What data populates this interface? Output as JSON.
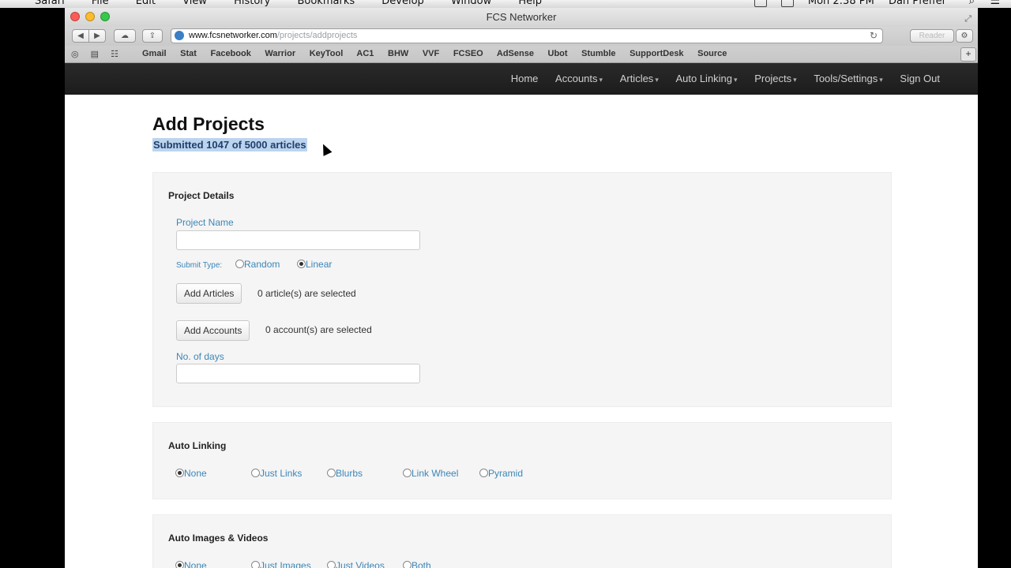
{
  "os_menubar": {
    "app": "Safari",
    "menus": [
      "Safari",
      "File",
      "Edit",
      "View",
      "History",
      "Bookmarks",
      "Develop",
      "Window",
      "Help"
    ],
    "clock": "Mon 2:38 PM",
    "user": "Dan Pfeffer"
  },
  "window": {
    "title": "FCS Networker"
  },
  "address_bar": {
    "domain": "www.fcsnetworker.com",
    "path": "/projects/addprojects",
    "reader_label": "Reader"
  },
  "bookmarks": [
    "Gmail",
    "Stat",
    "Facebook",
    "Warrior",
    "KeyTool",
    "AC1",
    "BHW",
    "VVF",
    "FCSEO",
    "AdSense",
    "Ubot",
    "Stumble",
    "SupportDesk",
    "Source"
  ],
  "site_nav": {
    "items": [
      {
        "label": "Home",
        "dropdown": false
      },
      {
        "label": "Accounts",
        "dropdown": true
      },
      {
        "label": "Articles",
        "dropdown": true
      },
      {
        "label": "Auto Linking",
        "dropdown": true
      },
      {
        "label": "Projects",
        "dropdown": true
      },
      {
        "label": "Tools/Settings",
        "dropdown": true
      },
      {
        "label": "Sign Out",
        "dropdown": false
      }
    ]
  },
  "page": {
    "title": "Add Projects",
    "submitted": "Submitted 1047 of 5000 articles"
  },
  "project_details": {
    "title": "Project Details",
    "project_name_label": "Project Name",
    "project_name_value": "",
    "submit_type_label": "Submit Type:",
    "submit_type_options": [
      "Random",
      "Linear"
    ],
    "submit_type_selected": "Linear",
    "add_articles_label": "Add Articles",
    "articles_selected_text": "0 article(s) are selected",
    "add_accounts_label": "Add Accounts",
    "accounts_selected_text": "0 account(s) are selected",
    "days_label": "No. of days",
    "days_value": ""
  },
  "auto_linking": {
    "title": "Auto Linking",
    "options": [
      "None",
      "Just Links",
      "Blurbs",
      "Link Wheel",
      "Pyramid"
    ],
    "selected": "None"
  },
  "auto_images": {
    "title": "Auto Images & Videos",
    "options": [
      "None",
      "Just Images",
      "Just Videos",
      "Both"
    ],
    "selected": "None"
  }
}
